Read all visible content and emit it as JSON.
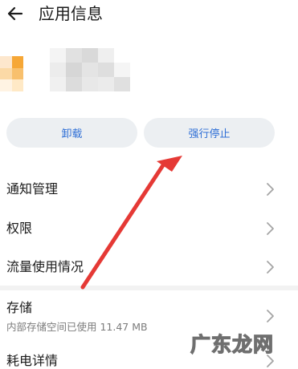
{
  "header": {
    "title": "应用信息",
    "back_icon": "arrow-left-icon"
  },
  "app": {
    "icon_colors": [
      "#f6a736",
      "#fbd9a6",
      "#ffe9c6",
      "#f8c06d"
    ],
    "name_obscured": true
  },
  "actions": {
    "uninstall_label": "卸载",
    "force_stop_label": "强行停止",
    "accent_color": "#2f6fd6"
  },
  "rows": [
    {
      "label": "通知管理",
      "icon": "chevron-right-icon"
    },
    {
      "label": "权限",
      "icon": "chevron-right-icon"
    },
    {
      "label": "流量使用情况",
      "icon": "chevron-right-icon"
    },
    {
      "label": "存储",
      "sub": "内部存储空间已使用 11.47 MB",
      "icon": "chevron-right-icon"
    },
    {
      "label": "耗电详情",
      "icon": "chevron-right-icon"
    }
  ],
  "annotation": {
    "arrow_color": "#e53935",
    "points_to": "force-stop-button"
  },
  "watermark": {
    "text": "广东龙网"
  }
}
